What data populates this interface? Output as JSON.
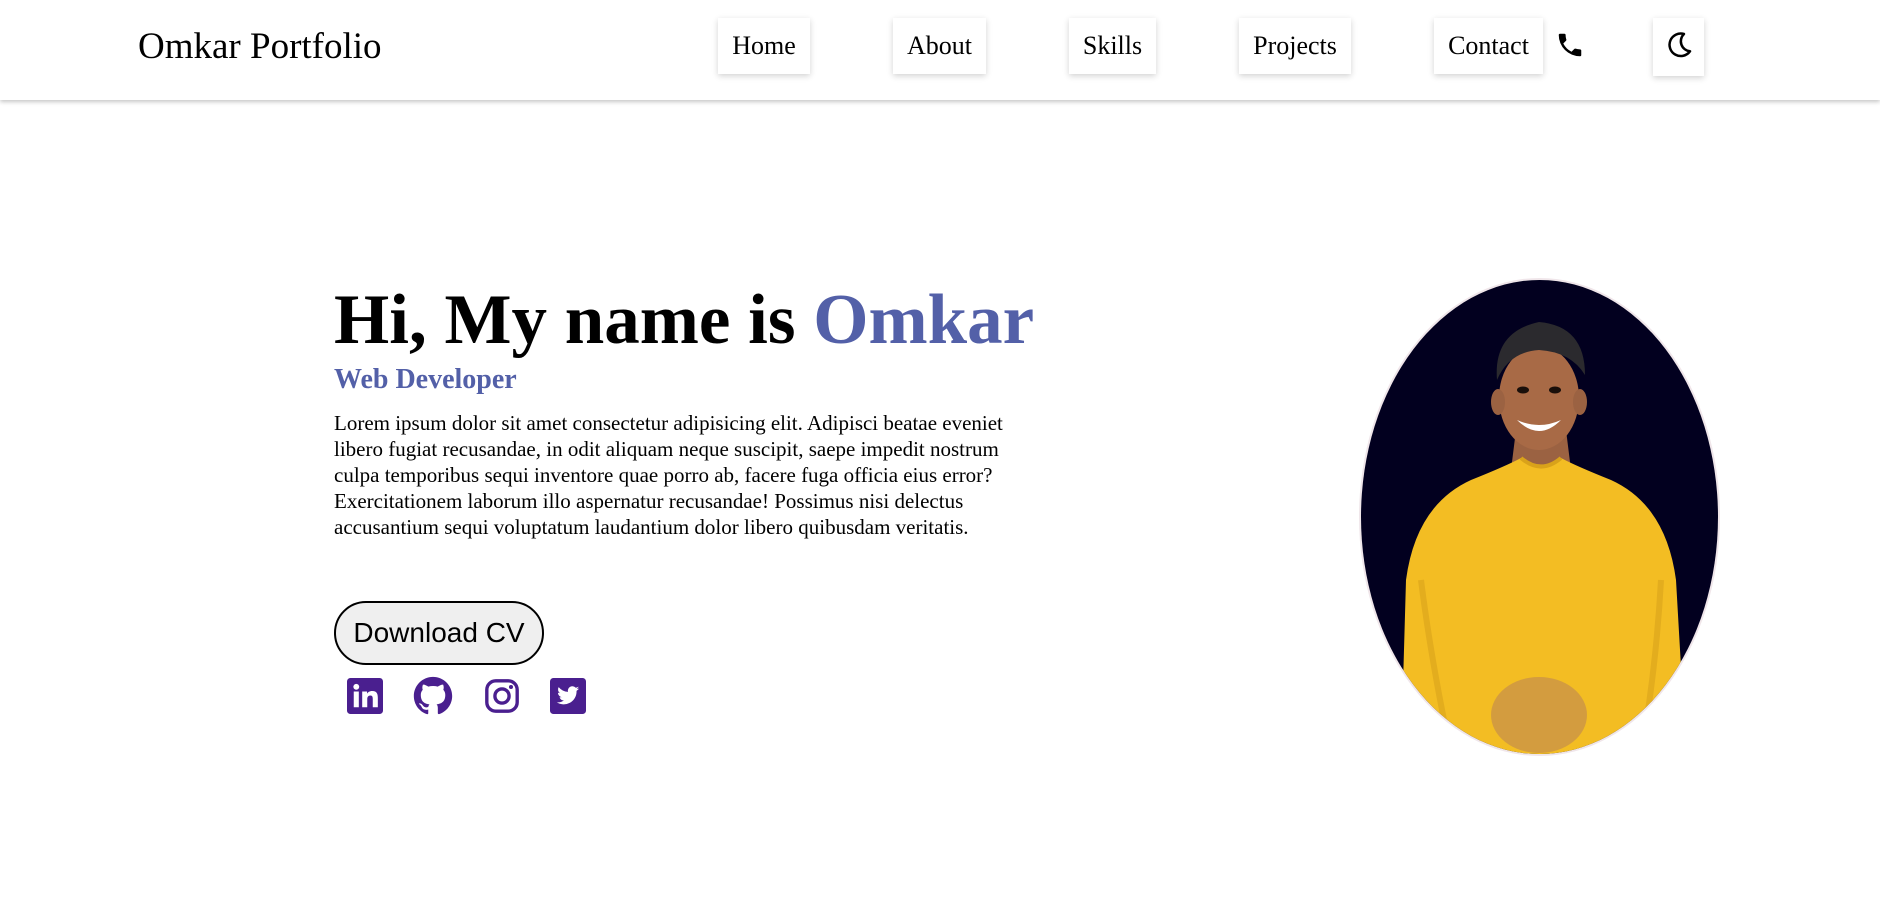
{
  "nav": {
    "brand": "Omkar Portfolio",
    "links": [
      {
        "label": "Home"
      },
      {
        "label": "About"
      },
      {
        "label": "Skills"
      },
      {
        "label": "Projects"
      },
      {
        "label": "Contact"
      }
    ],
    "phone_icon": "phone-icon",
    "theme_icon": "moon-icon"
  },
  "hero": {
    "title_prefix": "Hi, My name is ",
    "title_name": "Omkar",
    "role": "Web Developer",
    "description": "Lorem ipsum dolor sit amet consectetur adipisicing elit. Adipisci beatae eveniet libero fugiat recusandae, in odit aliquam neque suscipit, saepe impedit nostrum culpa temporibus sequi inventore quae porro ab, facere fuga officia eius error? Exercitationem laborum illo aspernatur recusandae! Possimus nisi delectus accusantium sequi voluptatum laudantium dolor libero quibusdam veritatis.",
    "cv_button": "Download CV",
    "social_icons": [
      "linkedin-icon",
      "github-icon",
      "instagram-icon",
      "twitter-icon"
    ]
  },
  "colors": {
    "accent": "#5360a8",
    "social": "#4a1f8f",
    "photo_bg": "#02001f",
    "shirt": "#f3bd23"
  }
}
